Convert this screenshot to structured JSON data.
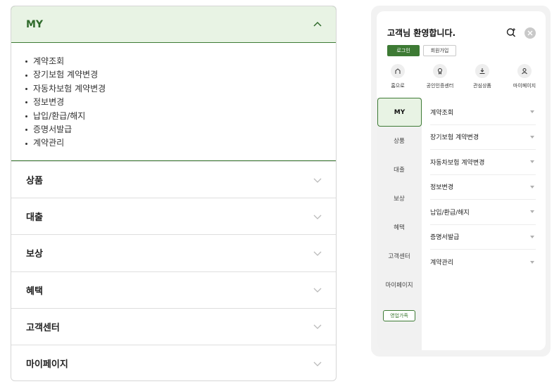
{
  "accordion": {
    "open_section": {
      "title": "MY",
      "items": [
        "계약조회",
        "장기보험 계약변경",
        "자동차보험 계약변경",
        "정보변경",
        "납입/환급/해지",
        "증명서발급",
        "계약관리"
      ]
    },
    "sections": [
      "상품",
      "대출",
      "보상",
      "혜택",
      "고객센터",
      "마이페이지"
    ]
  },
  "mobile": {
    "greeting": "고객님 환영합니다.",
    "login_label": "로그인",
    "join_label": "회원가입",
    "quick_links": [
      {
        "label": "홈으로",
        "icon": "home-icon"
      },
      {
        "label": "공인인증센터",
        "icon": "certificate-icon"
      },
      {
        "label": "관심상품",
        "icon": "download-icon"
      },
      {
        "label": "마이페이지",
        "icon": "user-icon"
      }
    ],
    "side_menu": [
      "MY",
      "상품",
      "대출",
      "보상",
      "혜택",
      "고객센터",
      "마이페이지"
    ],
    "sales_family_label": "영업가족",
    "sub_menu": [
      "계약조회",
      "장기보험 계약변경",
      "자동차보험 계약변경",
      "정보변경",
      "납입/환급/해지",
      "증명서발급",
      "계약관리"
    ]
  },
  "colors": {
    "accent": "#3d7a34",
    "accent_light": "#e8f3e4"
  }
}
